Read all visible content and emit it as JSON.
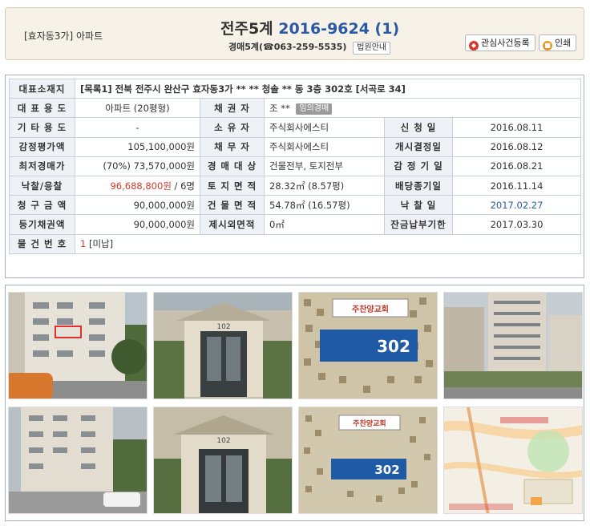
{
  "header": {
    "location": "[효자동3가]",
    "property_type": "아파트",
    "court_name": "전주5계",
    "case_number": "2016-9624 (1)",
    "contact": "경매5계(☎063-259-5535)",
    "court_guide_label": "법원안내",
    "interest_button_label": "관심사건등록",
    "print_button_label": "인쇄"
  },
  "info": {
    "address_label": "대표소재지",
    "address_value": "[목록1] 전북 전주시 완산구 효자동3가  ** ** 청솔 ** 동 3층 302호 [서곡로 34]",
    "main_use_label": "대 표 용 도",
    "main_use_value": "아파트 (20평형)",
    "creditor_label": "채 권 자",
    "creditor_value": "조 **",
    "creditor_badge": "임의경매",
    "other_use_label": "기 타 용 도",
    "other_use_value": "-",
    "owner_label": "소 유 자",
    "owner_value": "주식회사에스티",
    "filing_label": "신 청 일",
    "filing_value": "2016.08.11",
    "appraisal_label": "감정평가액",
    "appraisal_value": "105,100,000원",
    "debtor_label": "채 무 자",
    "debtor_value": "주식회사에스티",
    "commence_label": "개시결정일",
    "commence_value": "2016.08.12",
    "min_price_label": "최저경매가",
    "min_price_value": "(70%) 73,570,000원",
    "target_label": "경 매 대 상",
    "target_value": "건물전부, 토지전부",
    "appraisal_date_label": "감 정 기 일",
    "appraisal_date_value": "2016.08.21",
    "winning_bid_label": "낙찰/응찰",
    "winning_bid_value": "96,688,800원",
    "bidders_value": " / 6명",
    "land_area_label": "토 지 면 적",
    "land_area_value": "28.32㎡ (8.57평)",
    "dividend_label": "배당종기일",
    "dividend_value": "2016.11.14",
    "claim_label": "청 구 금 액",
    "claim_value": "90,000,000원",
    "building_area_label": "건 물 면 적",
    "building_area_value": "54.78㎡ (16.57평)",
    "sale_date_label": "낙 찰 일",
    "sale_date_value": "2017.02.27",
    "registered_claim_label": "등기채권액",
    "registered_claim_value": "90,000,000원",
    "excluded_area_label": "제시외면적",
    "excluded_area_value": "0㎡",
    "payment_deadline_label": "잔금납부기한",
    "payment_deadline_value": "2017.03.30",
    "item_number_label": "물 건 번 호",
    "item_number_value": "1",
    "item_status": "[미납]"
  },
  "photos": {
    "sign_church": "주찬양교회",
    "sign_unit": "302",
    "building_number": "102"
  }
}
